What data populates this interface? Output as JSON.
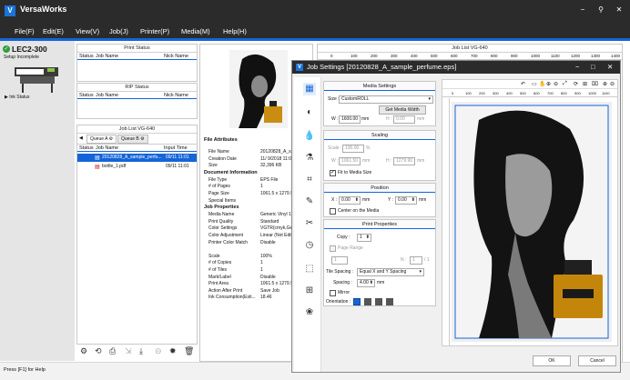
{
  "app": {
    "title": "VersaWorks",
    "logo_letter": "V"
  },
  "window_controls": {
    "minimize": "−",
    "maximize": "⚲",
    "close": "✕"
  },
  "menu": [
    "File(F)",
    "Edit(E)",
    "View(V)",
    "Job(J)",
    "Printer(P)",
    "Media(M)",
    "Help(H)"
  ],
  "printer": {
    "name": "LEC2-300",
    "status": "Setup Incomplete",
    "ink_status": "Ink Status"
  },
  "print_status": {
    "title": "Print Status",
    "col_status": "Status",
    "col_job": "Job Name",
    "col_nick": "Nick Name"
  },
  "rip_status": {
    "title": "RIP Status",
    "col_status": "Status",
    "col_job": "Job Name",
    "col_nick": "Nick Name"
  },
  "job_list": {
    "title": "Job List VG-640",
    "queue_a": "Queue A",
    "queue_b": "Queue B",
    "col_status": "Status",
    "col_job": "Job Name",
    "col_time": "Input Time",
    "rows": [
      {
        "name": "20120828_A_sample_perfu...",
        "time": "09/11 11:01",
        "selected": true
      },
      {
        "name": "bottle_1.pdf",
        "time": "09/11 11:01",
        "selected": false
      }
    ]
  },
  "file_attributes": {
    "heading": "File Attributes",
    "rows": [
      {
        "k": "File Name",
        "v": "20120828_A_samp"
      },
      {
        "k": "Creation Date",
        "v": "11/ 9/2018 11:01"
      },
      {
        "k": "Size",
        "v": "32,396 KB"
      }
    ]
  },
  "doc_info": {
    "heading": "Document Information",
    "rows": [
      {
        "k": "File Type",
        "v": "EPS File"
      },
      {
        "k": "# of Pages",
        "v": "1"
      },
      {
        "k": "Page Size",
        "v": "1061.5 x 1279.9 m"
      },
      {
        "k": "Special Items",
        "v": ""
      }
    ]
  },
  "job_props": {
    "heading": "Job Properties",
    "rows": [
      {
        "k": "Media Name",
        "v": "Generic Vinyl 1"
      },
      {
        "k": "Print Quality",
        "v": "Standard"
      },
      {
        "k": "Color Settings",
        "v": "VGTR(cmyk,Gener"
      },
      {
        "k": "Color Adjustment",
        "v": "Linear (Not Edite"
      },
      {
        "k": "Printer Color Match",
        "v": "Disable"
      },
      {
        "k": "",
        "v": ""
      },
      {
        "k": "Scale",
        "v": "100%"
      },
      {
        "k": "# of Copies",
        "v": "1"
      },
      {
        "k": "# of Tiles",
        "v": "1"
      },
      {
        "k": "Mark/Label",
        "v": "Disable"
      },
      {
        "k": "Print Area",
        "v": "1061.5 x 1279.9 m"
      },
      {
        "k": "Action After Print",
        "v": "Save Job"
      },
      {
        "k": "Ink Consumption(Esti...",
        "v": "18.46"
      }
    ]
  },
  "preview_list_title": "Job List VG-640",
  "ruler_ticks": [
    "0",
    "100",
    "200",
    "300",
    "400",
    "500",
    "600",
    "700",
    "800",
    "900",
    "1000",
    "1100",
    "1200",
    "1300",
    "1400"
  ],
  "dialog": {
    "title": "Job Settings [20120828_A_sample_perfume.eps]",
    "media": {
      "heading": "Media Settings",
      "size_label": "Size :",
      "size_value": "CustomROLL",
      "get_width": "Get Media Width",
      "w_label": "W :",
      "w_value": "1600.00",
      "h_label": "H :",
      "h_value": "0.00",
      "unit": "mm"
    },
    "scaling": {
      "heading": "Scaling",
      "scale_label": "Scale :",
      "scale_value": "100.00",
      "percent": "%",
      "w_label": "W :",
      "w_value": "1061.50",
      "h_label": "H :",
      "h_value": "1279.90",
      "unit": "mm",
      "fit_label": "Fit to Media Size"
    },
    "position": {
      "heading": "Position",
      "x_label": "X :",
      "x_value": "0.00",
      "y_label": "Y :",
      "y_value": "0.00",
      "unit": "mm",
      "center_label": "Center on the Media"
    },
    "print_props": {
      "heading": "Print Properties",
      "copy_label": "Copy :",
      "copy_value": "1",
      "page_range": "Page Range",
      "range_from": "1",
      "range_n": "N :",
      "range_to": "1",
      "range_total": "/ 1",
      "tile_label": "Tile Spacing :",
      "tile_value": "Equal X and Y Spacing",
      "spacing_label": "Spacing :",
      "spacing_value": "4.00",
      "mirror_label": "Mirror",
      "orientation_label": "Orientation :"
    },
    "ok": "OK",
    "cancel": "Cancel",
    "ruler_ticks": [
      "0",
      "100",
      "200",
      "300",
      "400",
      "500",
      "600",
      "700",
      "800",
      "900",
      "1000",
      "1100"
    ]
  },
  "statusbar": "Press [F1] for Help",
  "colors": {
    "accent": "#1565d8",
    "titlebar": "#2b2b2b",
    "selected_row": "#1565d8"
  }
}
